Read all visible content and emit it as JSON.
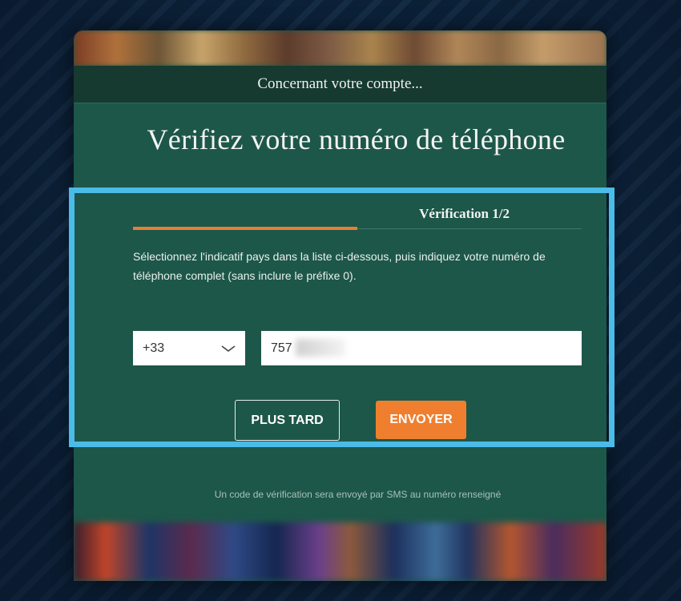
{
  "modal": {
    "header_text": "Concernant votre compte...",
    "title": "Vérifiez votre numéro de téléphone"
  },
  "verification": {
    "step_label": "Vérification 1/2",
    "progress": 0.5,
    "instructions": "Sélectionnez l'indicatif pays dans la liste ci-dessous, puis indiquez votre numéro de téléphone complet (sans inclure le préfixe 0).",
    "country_code": "+33",
    "phone_value": "757"
  },
  "actions": {
    "later_label": "PLUS TARD",
    "send_label": "ENVOYER"
  },
  "footer": {
    "sms_note": "Un code de vérification sera envoyé par SMS au numéro renseigné"
  },
  "colors": {
    "modal_bg": "#1d5749",
    "header_bg": "#163a30",
    "accent_orange": "#ef7f2f",
    "highlight_blue": "#4bbbe8",
    "backdrop": "#0f2a45"
  },
  "icons": {
    "select_chevron": "chevron-down-icon"
  }
}
